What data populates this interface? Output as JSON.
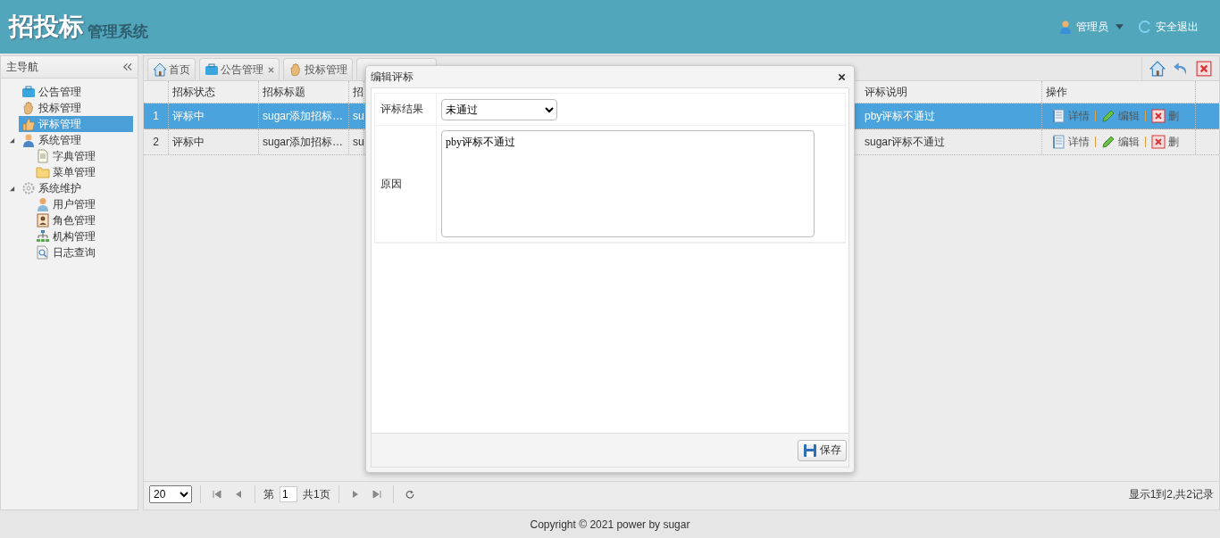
{
  "header": {
    "logo": "招投标",
    "subtitle": "管理系统",
    "user": "管理员",
    "logout": "安全退出"
  },
  "sidebar": {
    "title": "主导航",
    "items": [
      {
        "label": "公告管理",
        "selected": false
      },
      {
        "label": "投标管理",
        "selected": false
      },
      {
        "label": "评标管理",
        "selected": true
      },
      {
        "label": "系统管理",
        "selected": false,
        "expanded": true,
        "children": [
          {
            "label": "字典管理",
            "selected": false
          },
          {
            "label": "菜单管理",
            "selected": false
          }
        ]
      },
      {
        "label": "系统维护",
        "selected": false,
        "expanded": true,
        "children": [
          {
            "label": "用户管理",
            "selected": false
          },
          {
            "label": "角色管理",
            "selected": false
          },
          {
            "label": "机构管理",
            "selected": false
          },
          {
            "label": "日志查询",
            "selected": false
          }
        ]
      }
    ]
  },
  "tabs": [
    {
      "label": "首页",
      "selected": false,
      "closable": false
    },
    {
      "label": "公告管理",
      "selected": false,
      "closable": true
    },
    {
      "label": "投标管理",
      "selected": false,
      "closable": false
    }
  ],
  "table": {
    "columns": [
      "招标状态",
      "招标标题",
      "招",
      "评标说明",
      "操作"
    ],
    "rows": [
      {
        "number": "1",
        "selected": true,
        "cells": [
          "评标中",
          "sugar添加招标…",
          "su",
          "pby评标不通过"
        ],
        "actions": [
          "详情",
          "编辑",
          "删"
        ]
      },
      {
        "number": "2",
        "selected": false,
        "cells": [
          "评标中",
          "sugar添加招标…",
          "su",
          "sugar评标不通过"
        ],
        "actions": [
          "详情",
          "编辑",
          "删"
        ]
      }
    ]
  },
  "dialog": {
    "title": "编辑评标",
    "fields": [
      {
        "label": "评标结果",
        "kind": "select",
        "value": "未通过"
      },
      {
        "label": "原因",
        "kind": "textarea",
        "value": "pby评标不通过"
      }
    ],
    "buttons": [
      "保存"
    ]
  },
  "pager": {
    "page_size": "20",
    "page_prefix": "第",
    "page": "1",
    "page_total": "共1页",
    "summary": "显示1到2,共2记录"
  },
  "footer": "Copyright © 2021 power by sugar"
}
